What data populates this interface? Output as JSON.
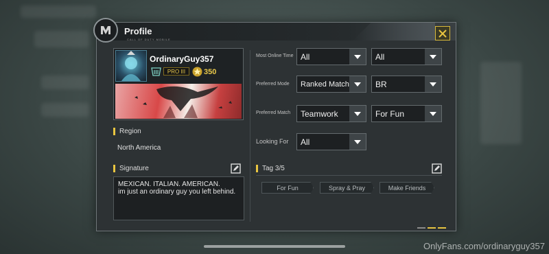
{
  "panel": {
    "title": "Profile",
    "subtitle": "CALL OF DUTY MOBILE",
    "close_icon": "close-x-icon"
  },
  "player": {
    "username": "OrdinaryGuy357",
    "rank_label": "PRO III",
    "points": "350"
  },
  "region": {
    "heading": "Region",
    "value": "North America"
  },
  "signature": {
    "heading": "Signature",
    "text": "MEXICAN. ITALIAN. AMERICAN.\nim just an ordinary guy you left behind."
  },
  "preferences": {
    "online_time": {
      "label": "Most Online Time",
      "value1": "All",
      "value2": "All"
    },
    "mode": {
      "label": "Preferred Mode",
      "value1": "Ranked Match",
      "value2": "BR"
    },
    "match": {
      "label": "Preferred Match",
      "value1": "Teamwork",
      "value2": "For Fun"
    },
    "looking_for": {
      "label": "Looking For",
      "value1": "All"
    }
  },
  "tags": {
    "heading": "Tag 3/5",
    "items": [
      "For Fun",
      "Spray & Pray",
      "Make Friends"
    ]
  },
  "watermark": "OnlyFans.com/ordinaryguy357",
  "colors": {
    "accent": "#e9c540",
    "panel_bg": "#2d3234"
  }
}
